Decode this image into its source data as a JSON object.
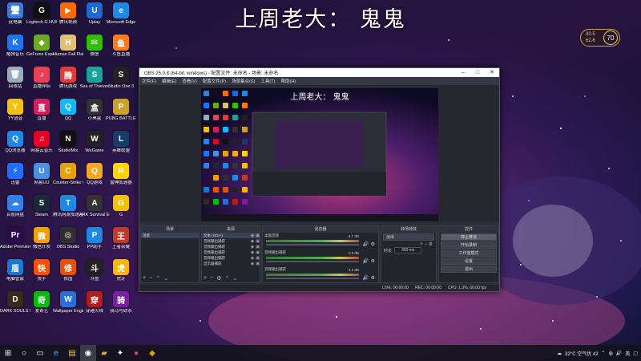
{
  "overlay_title": "上周老大：  鬼鬼",
  "widget": {
    "line1": "30.5",
    "line2": "62.6",
    "circle": "70"
  },
  "desktop_icons": [
    {
      "label": "此电脑",
      "color": "#3a7bd5",
      "glyph": "🖥"
    },
    {
      "label": "Logitech G HUB",
      "color": "#111111",
      "glyph": "G"
    },
    {
      "label": "腾讯视频",
      "color": "#ff6a00",
      "glyph": "▶"
    },
    {
      "label": "Uplay",
      "color": "#1c68d6",
      "glyph": "U"
    },
    {
      "label": "Microsoft Edge",
      "color": "#1e88e5",
      "glyph": "e"
    },
    {
      "label": "酷狗音乐",
      "color": "#1e74f0",
      "glyph": "K"
    },
    {
      "label": "GeForce Experience",
      "color": "#6aaa1e",
      "glyph": "◆"
    },
    {
      "label": "Human Fall Flat",
      "color": "#e0c070",
      "glyph": "H"
    },
    {
      "label": "微信",
      "color": "#2dc100",
      "glyph": "✉"
    },
    {
      "label": "斗鱼直播",
      "color": "#ff7a1a",
      "glyph": "鱼"
    },
    {
      "label": "回收站",
      "color": "#9ab",
      "glyph": "🗑"
    },
    {
      "label": "直播伴侣",
      "color": "#e94057",
      "glyph": "♪"
    },
    {
      "label": "腾讯游戏",
      "color": "#e53935",
      "glyph": "腾"
    },
    {
      "label": "Sea of Thieves",
      "color": "#1aa39a",
      "glyph": "S"
    },
    {
      "label": "Studio One 3",
      "color": "#222222",
      "glyph": "S"
    },
    {
      "label": "YY语音",
      "color": "#f4c20d",
      "glyph": "Y"
    },
    {
      "label": "直播",
      "color": "#d81b60",
      "glyph": "直"
    },
    {
      "label": "QQ",
      "color": "#12b7f5",
      "glyph": "Q"
    },
    {
      "label": "小黑盒",
      "color": "#333333",
      "glyph": "盒"
    },
    {
      "label": "PUBG BATTLEGROUNDS",
      "color": "#c9a227",
      "glyph": "P"
    },
    {
      "label": "QQ浏览器",
      "color": "#1e88e5",
      "glyph": "Q"
    },
    {
      "label": "网易云音乐",
      "color": "#e60026",
      "glyph": "♫"
    },
    {
      "label": "StudioMix",
      "color": "#111111",
      "glyph": "N"
    },
    {
      "label": "WeGame",
      "color": "#222222",
      "glyph": "W"
    },
    {
      "label": "英雄联盟",
      "color": "#1a3a6a",
      "glyph": "L"
    },
    {
      "label": "迅雷",
      "color": "#1e6fff",
      "glyph": "⚡"
    },
    {
      "label": "网易UU",
      "color": "#4a90e2",
      "glyph": "U"
    },
    {
      "label": "Counter-Strike Global Off.",
      "color": "#e8a200",
      "glyph": "C"
    },
    {
      "label": "QQ游戏",
      "color": "#f5a623",
      "glyph": "Q"
    },
    {
      "label": "雷神加速器",
      "color": "#ffd400",
      "glyph": "R"
    },
    {
      "label": "百度网盘",
      "color": "#2f80ed",
      "glyph": "☁"
    },
    {
      "label": "Steam",
      "color": "#1b2838",
      "glyph": "S"
    },
    {
      "label": "腾讯网游加速器",
      "color": "#1e88e5",
      "glyph": "T"
    },
    {
      "label": "ARK Survival Evolved",
      "color": "#333333",
      "glyph": "A"
    },
    {
      "label": "G",
      "color": "#f5c000",
      "glyph": "G"
    },
    {
      "label": "Adobe Premiere Pro",
      "color": "#2a0c4e",
      "glyph": "Pr"
    },
    {
      "label": "微信开发",
      "color": "#f0a000",
      "glyph": "微"
    },
    {
      "label": "OBS Studio",
      "color": "#302e31",
      "glyph": "◎"
    },
    {
      "label": "PP助手",
      "color": "#1e88e5",
      "glyph": "P"
    },
    {
      "label": "王者荣耀",
      "color": "#c0392b",
      "glyph": "王"
    },
    {
      "label": "电脑管家",
      "color": "#1976d2",
      "glyph": "盾"
    },
    {
      "label": "快手",
      "color": "#ff5000",
      "glyph": "快"
    },
    {
      "label": "修图",
      "color": "#e65100",
      "glyph": "修"
    },
    {
      "label": "斗鱼",
      "color": "#222222",
      "glyph": "斗"
    },
    {
      "label": "虎牙",
      "color": "#ffb400",
      "glyph": "虎"
    },
    {
      "label": "DARK SOULS III",
      "color": "#3a2a1a",
      "glyph": "D"
    },
    {
      "label": "爱奇艺",
      "color": "#00be06",
      "glyph": "奇"
    },
    {
      "label": "Wallpaper Engine",
      "color": "#2a6fd6",
      "glyph": "W"
    },
    {
      "label": "穿越火线",
      "color": "#b71c1c",
      "glyph": "穿"
    },
    {
      "label": "骑马与砍杀",
      "color": "#7b1fa2",
      "glyph": "骑"
    }
  ],
  "obs": {
    "title": "OBS 25.0.8 (64-bit, windows) - 配置文件: 未命名 - 场景: 未命名",
    "menu": [
      "文件(F)",
      "编辑(E)",
      "查看(V)",
      "配置文件(P)",
      "场景集合(S)",
      "工具(T)",
      "帮助(H)"
    ],
    "preview_title": "上周老大：  鬼鬼",
    "docks": {
      "scenes": {
        "header": "场景",
        "items": [
          "场景"
        ]
      },
      "sources": {
        "header": "来源",
        "items": [
          "文本 (GDI+)",
          "音频输出捕获",
          "音频输出捕获",
          "音频输出捕获",
          "音频输出捕获",
          "显示器捕获"
        ]
      },
      "mixer": {
        "header": "混音器",
        "channels": [
          {
            "name": "桌面音频",
            "value": "-4.7 dB"
          },
          {
            "name": "音频输出捕获",
            "value": "0.0 dB"
          },
          {
            "name": "音频输出捕获",
            "value": "-1.0 dB"
          }
        ]
      },
      "transitions": {
        "header": "转场特效",
        "type": "淡出",
        "duration_label": "时长",
        "duration": "300 ms"
      },
      "controls": {
        "header": "控件",
        "buttons": [
          "停止推流",
          "开始录制",
          "工作室模式",
          "设置",
          "退出"
        ]
      }
    },
    "status": {
      "live": "LIVE: 00:00:00",
      "rec": "REC: 00:00:00",
      "cpu": "CPU: 1.3%, 60.00 fps"
    }
  },
  "taskbar": {
    "weather": "32°C 空气优 42",
    "time": "",
    "start_icon": "windows-start-icon",
    "items": [
      "search-icon",
      "task-view-icon",
      "edge-icon",
      "explorer-icon",
      "store-icon",
      "obs-icon",
      "folder-icon",
      "game-icon",
      "app-icon",
      "app2-icon"
    ]
  }
}
